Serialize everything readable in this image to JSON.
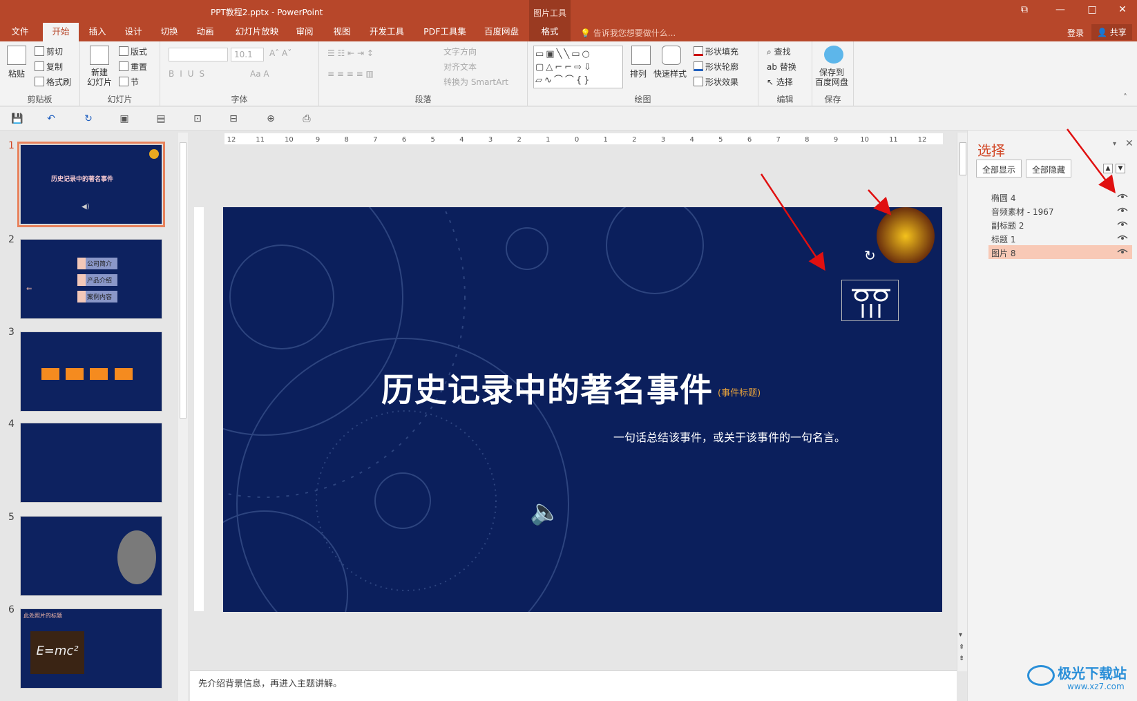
{
  "window": {
    "title": "PPT教程2.pptx - PowerPoint",
    "context_tool": "图片工具"
  },
  "tabs": [
    "文件",
    "开始",
    "插入",
    "设计",
    "切换",
    "动画",
    "幻灯片放映",
    "审阅",
    "视图",
    "开发工具",
    "PDF工具集",
    "百度网盘",
    "格式"
  ],
  "active_tab": "开始",
  "tell_me": "告诉我您想要做什么...",
  "account": {
    "login": "登录",
    "share": "共享"
  },
  "ribbon": {
    "clipboard": {
      "paste": "粘贴",
      "cut": "剪切",
      "copy": "复制",
      "format_painter": "格式刷",
      "label": "剪贴板"
    },
    "slides": {
      "new_slide": "新建\n幻灯片",
      "layout": "版式",
      "reset": "重置",
      "section": "节",
      "label": "幻灯片"
    },
    "font": {
      "font_size": "10.1",
      "label": "字体"
    },
    "paragraph": {
      "text_direction": "文字方向",
      "align_text": "对齐文本",
      "smartart": "转换为 SmartArt",
      "label": "段落"
    },
    "drawing": {
      "arrange": "排列",
      "quick_styles": "快速样式",
      "shape_fill": "形状填充",
      "shape_outline": "形状轮廓",
      "shape_effects": "形状效果",
      "label": "绘图"
    },
    "editing": {
      "find": "查找",
      "replace": "替换",
      "select": "选择",
      "label": "编辑"
    },
    "save": {
      "save_to": "保存到\n百度网盘",
      "label": "保存"
    }
  },
  "thumbnails": {
    "numbers": [
      "1",
      "2",
      "3",
      "4",
      "5",
      "6"
    ],
    "t1_title": "历史记录中的著名事件",
    "t2_items": [
      "公司简介",
      "产品介绍",
      "案例内容"
    ],
    "t6_title": "此处照片的标题"
  },
  "slide": {
    "title": "历史记录中的著名事件",
    "title_tag": "(事件标题)",
    "subtitle": "一句话总结该事件，或关于该事件的一句名言。"
  },
  "notes": "先介绍背景信息，再进入主题讲解。",
  "ruler_labels": [
    "12",
    "11",
    "10",
    "9",
    "8",
    "7",
    "6",
    "5",
    "4",
    "3",
    "2",
    "1",
    "0",
    "1",
    "2",
    "3",
    "4",
    "5",
    "6",
    "7",
    "8",
    "9",
    "10",
    "11",
    "12"
  ],
  "selection_pane": {
    "title": "选择",
    "show_all": "全部显示",
    "hide_all": "全部隐藏",
    "items": [
      "椭圆 4",
      "音频素材 - 1967",
      "副标题 2",
      "标题 1",
      "图片 8"
    ],
    "selected": "图片 8"
  },
  "watermark": {
    "text": "极光下载站",
    "url": "www.xz7.com"
  },
  "colors": {
    "accent": "#b7472a",
    "slide_bg": "#0b1f5c",
    "selection": "#f8c9b6"
  }
}
